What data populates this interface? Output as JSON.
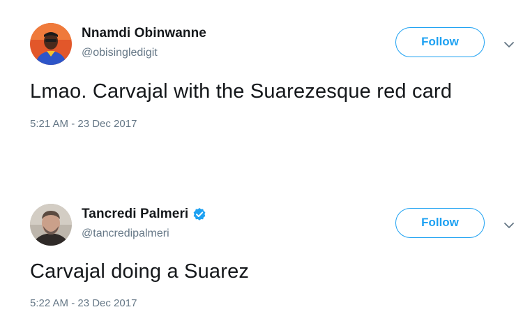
{
  "tweets": [
    {
      "display_name": "Nnamdi Obinwanne",
      "handle": "@obisingledigit",
      "verified": false,
      "follow_label": "Follow",
      "text": "Lmao. Carvajal with the Suarezesque red card",
      "timestamp": "5:21 AM - 23 Dec 2017",
      "avatar_icon": "avatar-photo"
    },
    {
      "display_name": "Tancredi Palmeri",
      "handle": "@tancredipalmeri",
      "verified": true,
      "follow_label": "Follow",
      "text": "Carvajal doing a Suarez",
      "timestamp": "5:22 AM - 23 Dec 2017",
      "avatar_icon": "avatar-photo"
    }
  ],
  "colors": {
    "accent": "#1da1f2",
    "text": "#14171a",
    "muted": "#657786"
  },
  "icons": {
    "verified": "verified-badge-icon",
    "caret": "chevron-down-icon"
  }
}
